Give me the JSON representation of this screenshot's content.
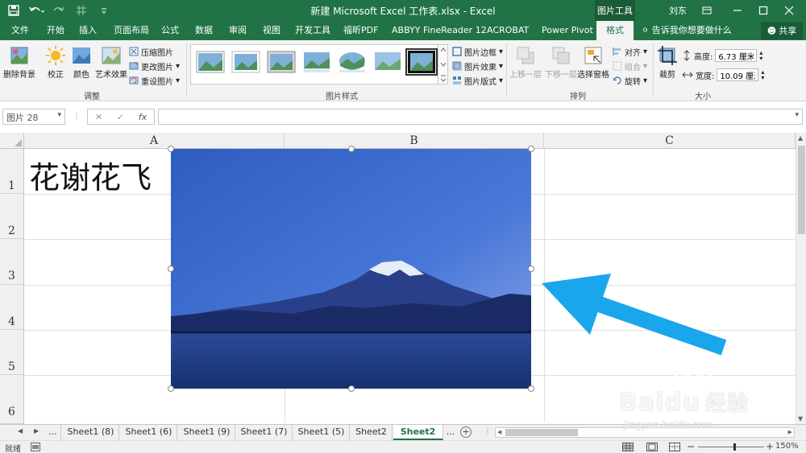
{
  "window": {
    "title": "新建 Microsoft Excel 工作表.xlsx  -  Excel",
    "context_tab_group": "图片工具",
    "user": "刘东",
    "share_label": "共享"
  },
  "tabs": [
    {
      "label": "文件",
      "active": false
    },
    {
      "label": "开始",
      "active": false
    },
    {
      "label": "插入",
      "active": false
    },
    {
      "label": "页面布局",
      "active": false
    },
    {
      "label": "公式",
      "active": false
    },
    {
      "label": "数据",
      "active": false
    },
    {
      "label": "审阅",
      "active": false
    },
    {
      "label": "视图",
      "active": false
    },
    {
      "label": "开发工具",
      "active": false
    },
    {
      "label": "福昕PDF",
      "active": false
    },
    {
      "label": "ABBYY FineReader 12",
      "active": false
    },
    {
      "label": "ACROBAT",
      "active": false
    },
    {
      "label": "Power Pivot",
      "active": false
    },
    {
      "label": "格式",
      "active": true
    }
  ],
  "tell_me": "告诉我你想要做什么",
  "ribbon": {
    "adjust": {
      "label": "调整",
      "remove_bg": "删除背景",
      "correct": "校正",
      "color": "颜色",
      "artistic": "艺术效果",
      "compress": "压缩图片",
      "change": "更改图片",
      "reset": "重设图片"
    },
    "styles": {
      "label": "图片样式",
      "border": "图片边框",
      "effects": "图片效果",
      "layout": "图片版式"
    },
    "arrange": {
      "label": "排列",
      "bring_forward": "上移一层",
      "send_backward": "下移一层",
      "selection_pane": "选择窗格",
      "align": "对齐",
      "group": "组合",
      "rotate": "旋转"
    },
    "size": {
      "label": "大小",
      "crop": "裁剪",
      "height_label": "高度:",
      "height_value": "6.73 厘米",
      "width_label": "宽度:",
      "width_value": "10.09 厘米"
    }
  },
  "formula_bar": {
    "name_box": "图片 28",
    "fx": "fx",
    "formula": ""
  },
  "grid": {
    "columns": [
      "A",
      "B",
      "C"
    ],
    "rows": [
      "1",
      "2",
      "3",
      "4",
      "5",
      "6"
    ],
    "cell_a1": "花谢花飞"
  },
  "sheets": [
    {
      "label": "...",
      "active": false
    },
    {
      "label": "Sheet1 (8)",
      "active": false
    },
    {
      "label": "Sheet1 (6)",
      "active": false
    },
    {
      "label": "Sheet1 (9)",
      "active": false
    },
    {
      "label": "Sheet1 (7)",
      "active": false
    },
    {
      "label": "Sheet1 (5)",
      "active": false
    },
    {
      "label": "Sheet2",
      "active": false
    },
    {
      "label": "Sheet2 (2)",
      "active": true
    },
    {
      "label": "...",
      "active": false
    }
  ],
  "status": {
    "ready": "就绪",
    "zoom": "150%"
  },
  "watermark": {
    "brand": "Bai",
    "brand_tail": "du",
    "product": "经验",
    "url": "jingyan.baidu.com"
  },
  "colors": {
    "excel_green": "#217346",
    "arrow": "#1aa6ec"
  }
}
